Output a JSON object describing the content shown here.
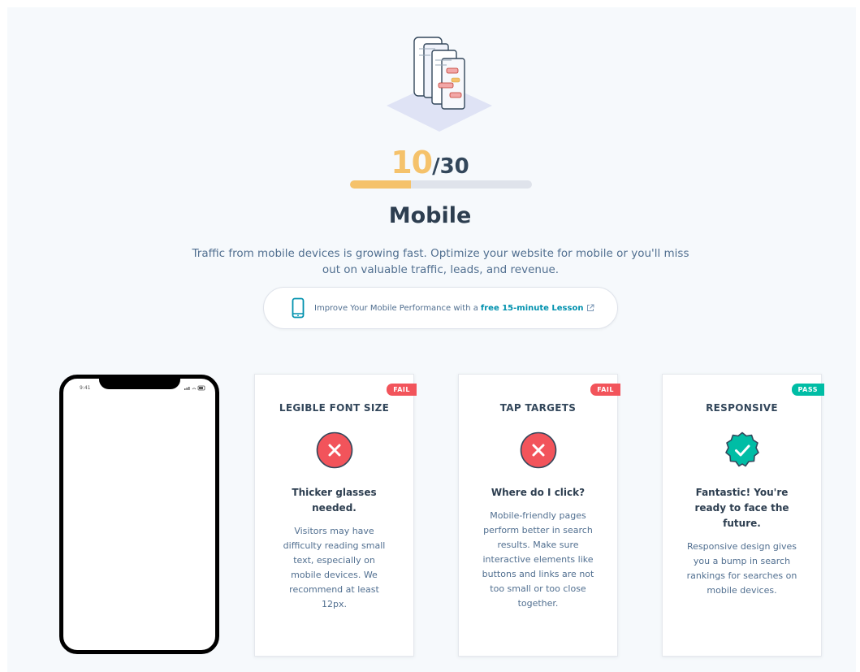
{
  "score": {
    "current": "10",
    "total": "/30",
    "progress_fraction": 0.333
  },
  "section": {
    "title": "Mobile",
    "description": "Traffic from mobile devices is growing fast. Optimize your website for mobile or you'll miss out on valuable traffic, leads, and revenue."
  },
  "lesson": {
    "text": "Improve Your Mobile Performance with a",
    "link_text": "free 15-minute Lesson",
    "icon": "phone-icon"
  },
  "phone_preview": {
    "time": "9:41"
  },
  "cards": [
    {
      "title": "LEGIBLE FONT SIZE",
      "badge": "FAIL",
      "status": "fail",
      "headline": "Thicker glasses needed.",
      "body": "Visitors may have difficulty reading small text, especially on mobile devices. We recommend at least 12px."
    },
    {
      "title": "TAP TARGETS",
      "badge": "FAIL",
      "status": "fail",
      "headline": "Where do I click?",
      "body": "Mobile-friendly pages perform better in search results. Make sure interactive elements like buttons and links are not too small or too close together."
    },
    {
      "title": "RESPONSIVE",
      "badge": "PASS",
      "status": "pass",
      "headline": "Fantastic! You're ready to face the future.",
      "body": "Responsive design gives you a bump in search rankings for searches on mobile devices."
    }
  ],
  "colors": {
    "score_accent": "#f5c26b",
    "fail": "#f2545b",
    "pass": "#00bda5",
    "link": "#0091ae"
  }
}
